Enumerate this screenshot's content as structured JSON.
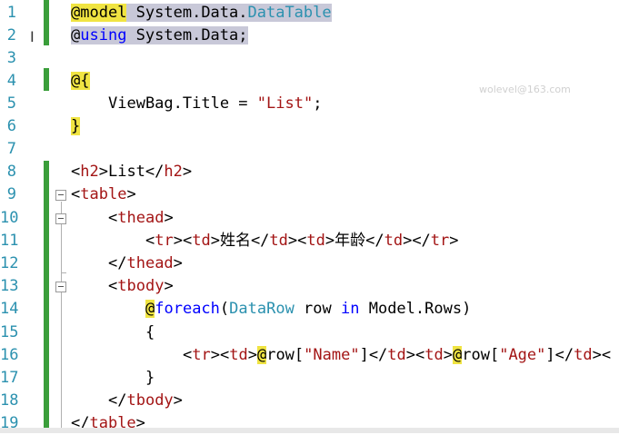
{
  "editor": {
    "line_numbers": [
      "1",
      "2",
      "3",
      "4",
      "5",
      "6",
      "7",
      "8",
      "9",
      "10",
      "11",
      "12",
      "13",
      "14",
      "15",
      "16",
      "17",
      "18",
      "19"
    ],
    "watermark": "wolevel@163.com",
    "lines": {
      "l1": [
        "@",
        "model",
        " System.Data.",
        "DataTable"
      ],
      "l2": [
        "@",
        "using",
        " System.Data;"
      ],
      "l4": [
        "@",
        "{"
      ],
      "l5": [
        "ViewBag.Title = ",
        "\"List\"",
        ";"
      ],
      "l6": [
        "}"
      ],
      "l8": [
        "<",
        "h2",
        ">List</",
        "h2",
        ">"
      ],
      "l9": [
        "<",
        "table",
        ">"
      ],
      "l10": [
        "<",
        "thead",
        ">"
      ],
      "l11": [
        "<",
        "tr",
        "><",
        "td",
        ">姓名</",
        "td",
        "><",
        "td",
        ">年龄</",
        "td",
        "></",
        "tr",
        ">"
      ],
      "l12": [
        "</",
        "thead",
        ">"
      ],
      "l13": [
        "<",
        "tbody",
        ">"
      ],
      "l14": [
        "@",
        "foreach",
        "(",
        "DataRow",
        " row ",
        "in",
        " Model.Rows)"
      ],
      "l15": [
        "{"
      ],
      "l16": [
        "<",
        "tr",
        "><",
        "td",
        ">",
        "@",
        "row[",
        "\"Name\"",
        "]</",
        "td",
        "><",
        "td",
        ">",
        "@",
        "row[",
        "\"Age\"",
        "]</",
        "td",
        "><"
      ],
      "l17": [
        "}"
      ],
      "l18": [
        "</",
        "tbody",
        ">"
      ],
      "l19": [
        "</",
        "table",
        ">"
      ]
    }
  }
}
